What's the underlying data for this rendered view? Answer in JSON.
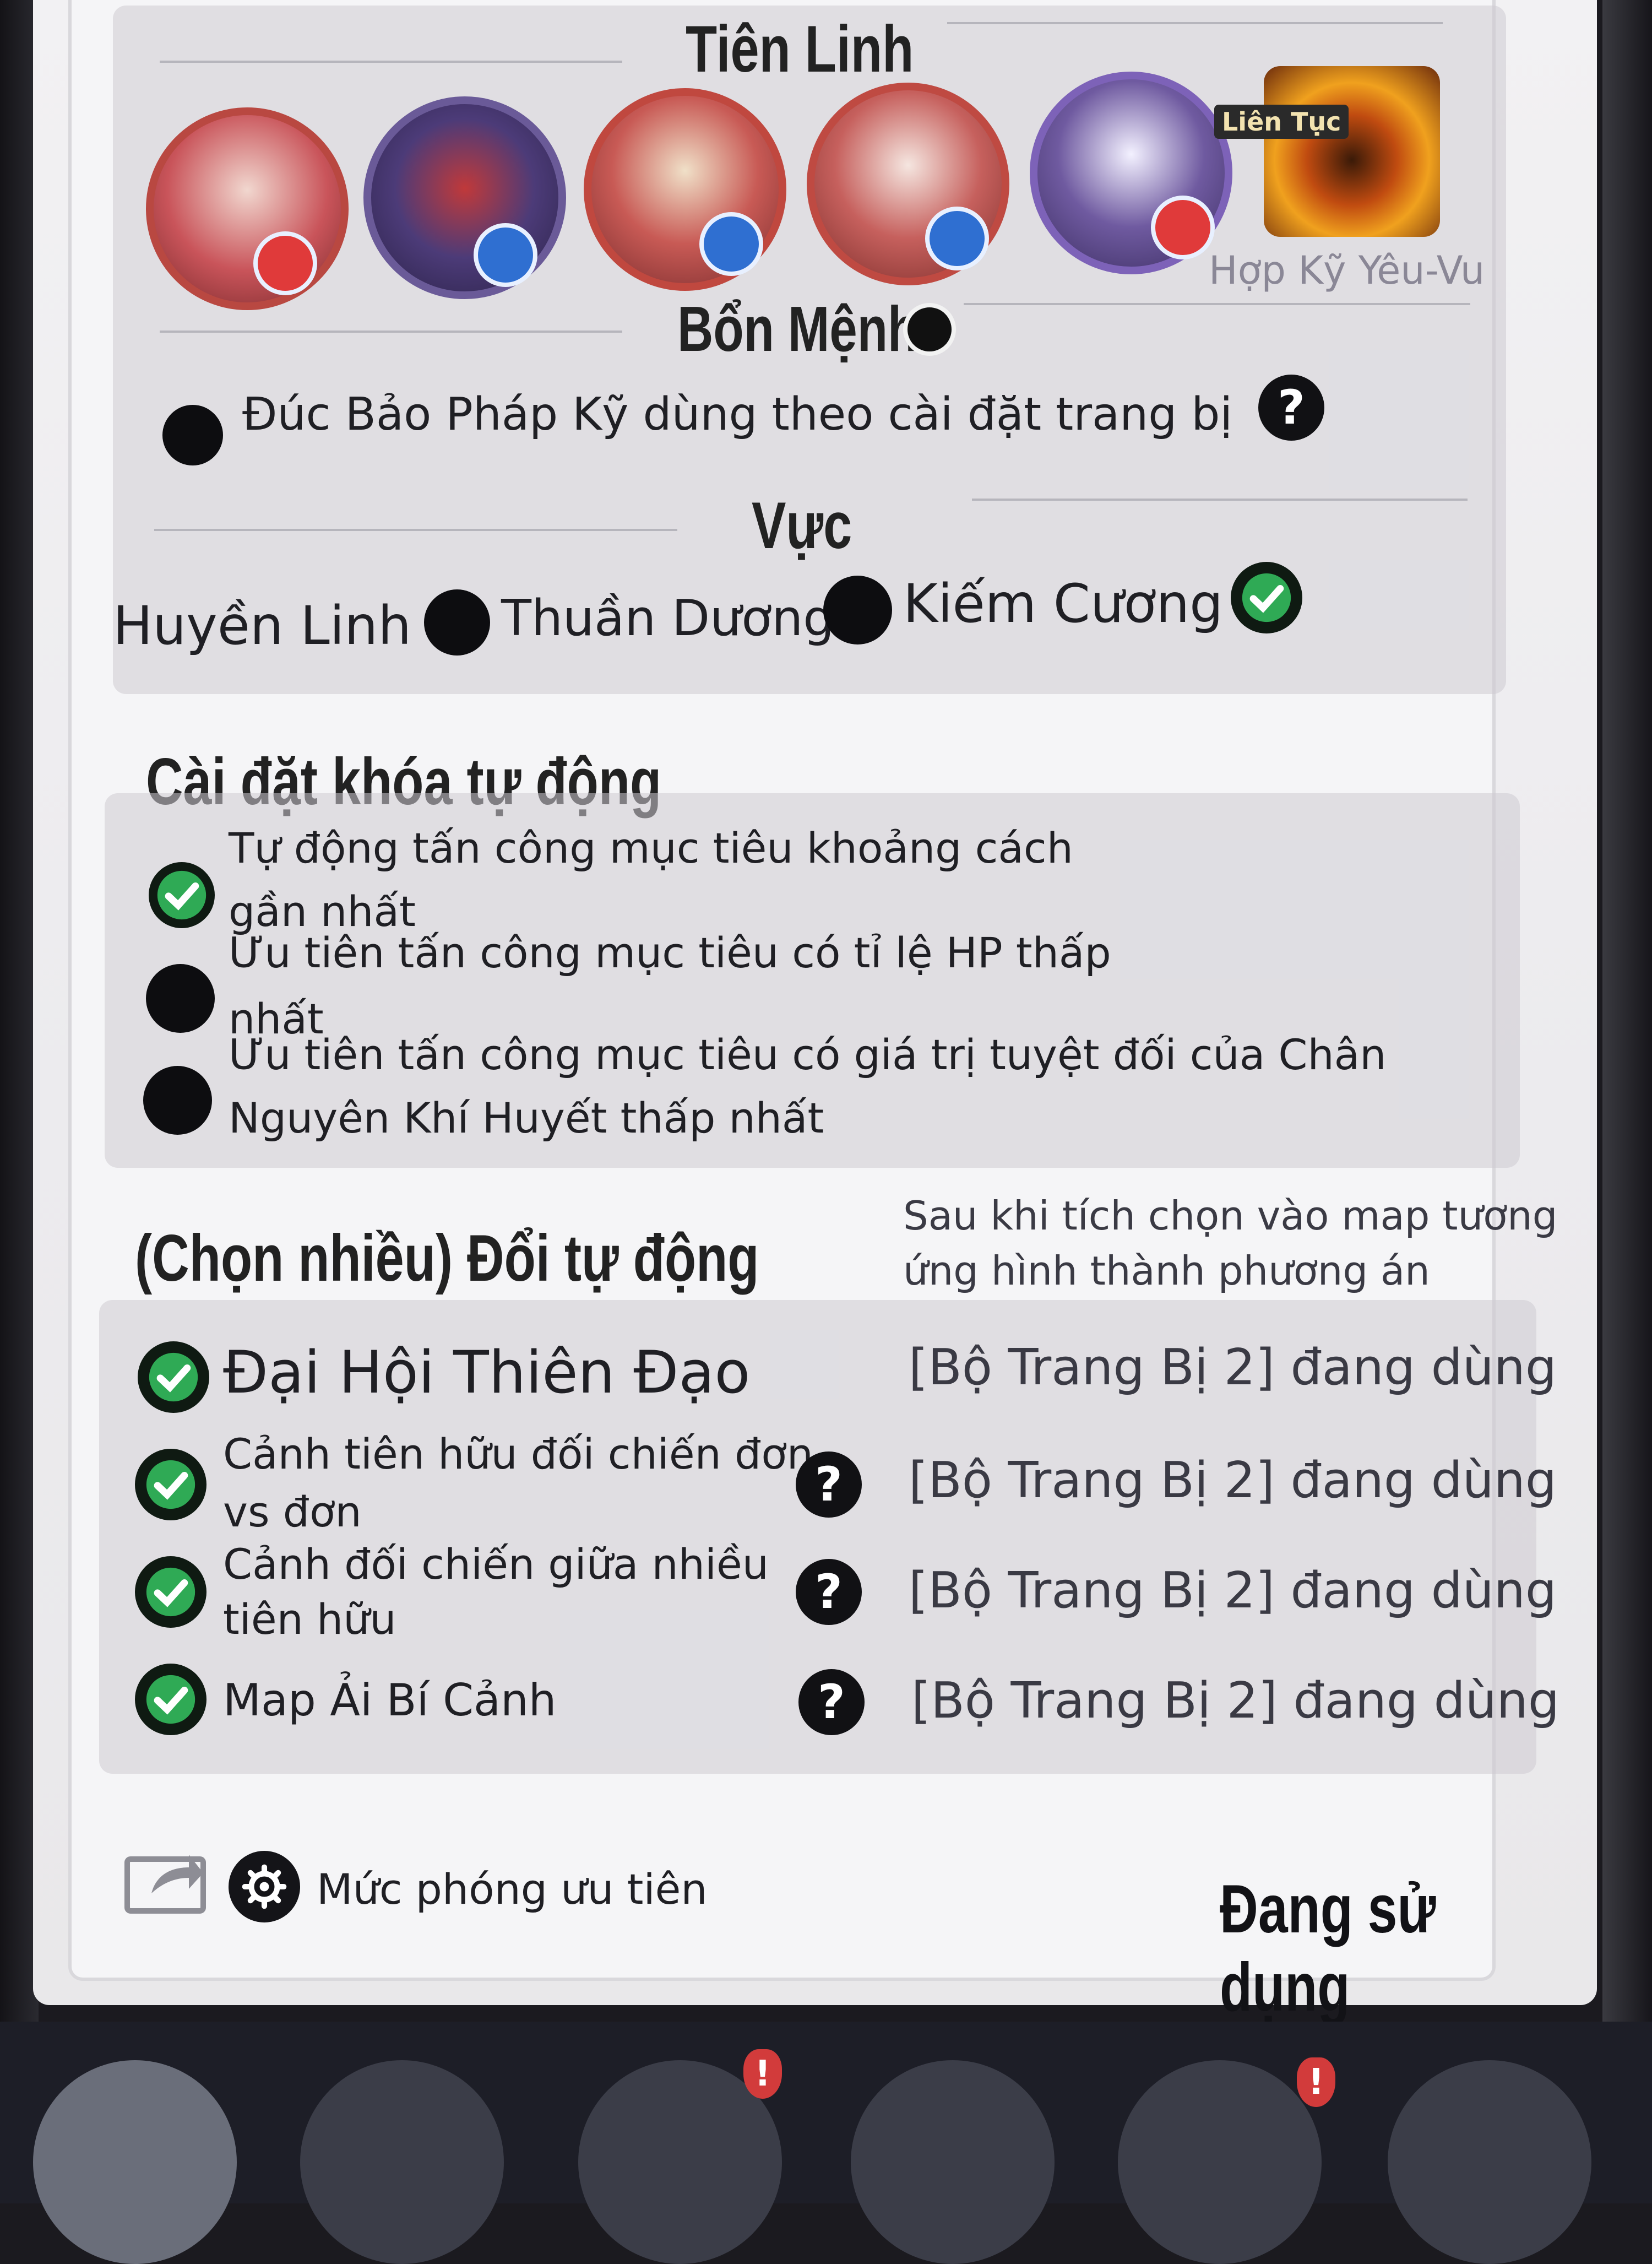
{
  "tien_linh": {
    "title": "Tiên Linh",
    "avatars": [
      {
        "name": "avatar-1",
        "bg": "#c9545a",
        "badge": "#e03a3a"
      },
      {
        "name": "avatar-2",
        "bg": "#4c3b78",
        "badge": "#2f6fd1"
      },
      {
        "name": "avatar-3",
        "bg": "#c85a55",
        "badge": "#2f6fd1"
      },
      {
        "name": "avatar-4",
        "bg": "#c6605d",
        "badge": "#2f6fd1"
      },
      {
        "name": "avatar-5",
        "bg": "#6f5aa0",
        "badge": "#e03a3a"
      }
    ],
    "skill_tag": "Liên Tục",
    "skill_label": "Hợp Kỹ Yêu-Vu"
  },
  "ban_menh": {
    "title": "Bổn Mệnh",
    "option": "Đúc Bảo Pháp Kỹ dùng theo cài đặt trang bị"
  },
  "vuc": {
    "title": "Vực",
    "options": [
      {
        "label": "Huyền Linh",
        "checked": false
      },
      {
        "label": "Thuần Dương",
        "checked": false
      },
      {
        "label": "Kiếm Cương",
        "checked": true
      }
    ]
  },
  "auto_lock": {
    "title": "Cài đặt khóa tự động",
    "options": [
      {
        "line1": "Tự động tấn công mục tiêu khoảng cách",
        "line2": "gần nhất",
        "checked": true
      },
      {
        "line1": "Ưu tiên tấn công mục tiêu có tỉ lệ HP thấp",
        "line2": "nhất",
        "checked": false
      },
      {
        "line1": "Ưu tiên tấn công mục tiêu có giá trị tuyệt đối của Chân",
        "line2": "Nguyên Khí Huyết thấp nhất",
        "checked": false
      }
    ]
  },
  "auto_switch": {
    "title": "(Chọn nhiều) Đổi tự động",
    "hint_line1": "Sau khi tích chọn vào map tương",
    "hint_line2": "ứng hình thành phương án",
    "rows": [
      {
        "line1": "Đại Hội Thiên Đạo",
        "line2": "",
        "status": "[Bộ Trang Bị 2] đang dùng",
        "help": false
      },
      {
        "line1": "Cảnh tiên hữu đối chiến đơn",
        "line2": "vs đơn",
        "status": "[Bộ Trang Bị 2] đang dùng",
        "help": true
      },
      {
        "line1": "Cảnh đối chiến giữa nhiều",
        "line2": "tiên hữu",
        "status": "[Bộ Trang Bị 2] đang dùng",
        "help": true
      },
      {
        "line1": "Map Ải Bí Cảnh",
        "line2": "",
        "status": "[Bộ Trang Bị 2] đang dùng",
        "help": true
      }
    ]
  },
  "footer": {
    "priority_label": "Mức phóng ưu tiên",
    "status": "Đang sử dụng"
  },
  "help_glyph": "?",
  "alert_glyph": "!"
}
